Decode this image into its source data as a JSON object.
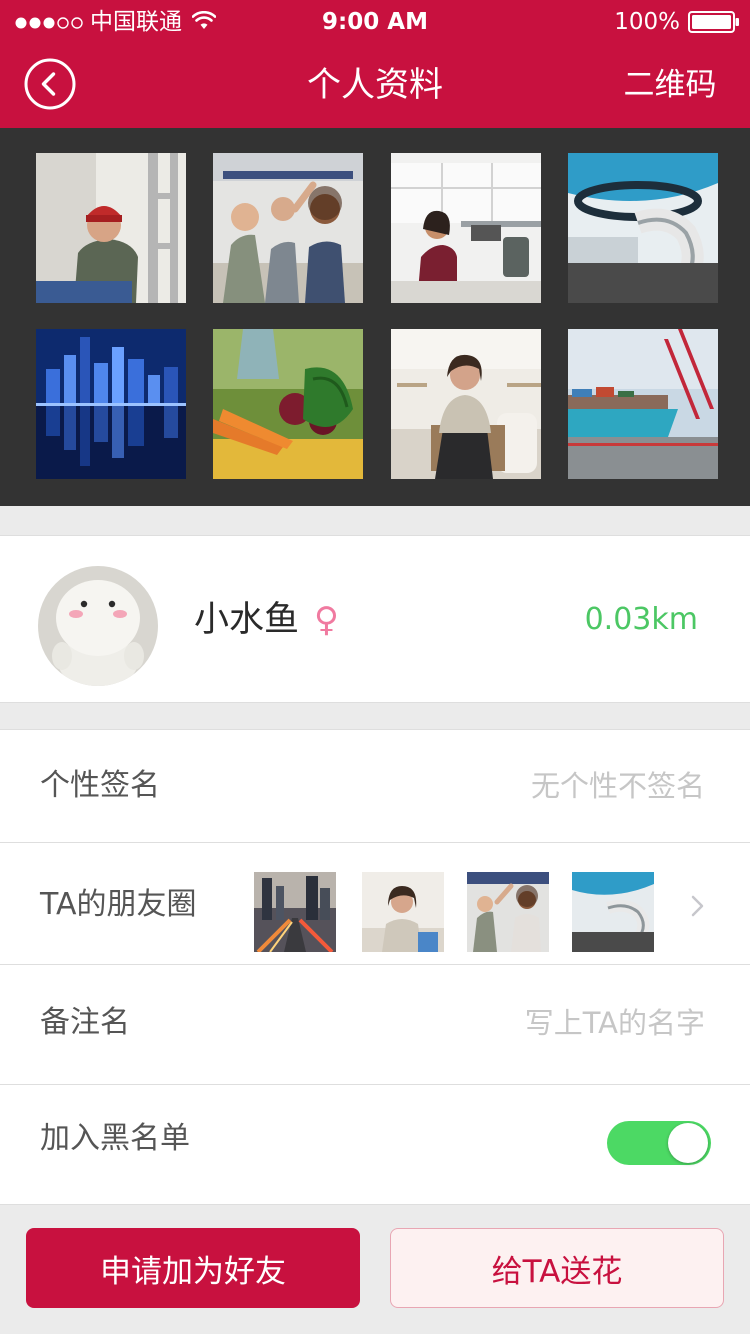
{
  "status": {
    "carrier": "中国联通",
    "time": "9:00 AM",
    "battery": "100%"
  },
  "nav": {
    "title": "个人资料",
    "right_label": "二维码"
  },
  "profile": {
    "name": "小水鱼",
    "gender_symbol": "♀",
    "distance": "0.03km"
  },
  "rows": {
    "signature": {
      "label": "个性签名",
      "value": "无个性不签名"
    },
    "moments": {
      "label": "TA的朋友圈"
    },
    "remark": {
      "label": "备注名",
      "placeholder": "写上TA的名字"
    },
    "blacklist": {
      "label": "加入黑名单",
      "enabled": true
    }
  },
  "buttons": {
    "add_friend": "申请加为好友",
    "send_flower": "给TA送花"
  },
  "colors": {
    "brand": "#c8113f",
    "distance": "#4cc764",
    "toggle_on": "#4cd964",
    "gender": "#f07aa0"
  }
}
